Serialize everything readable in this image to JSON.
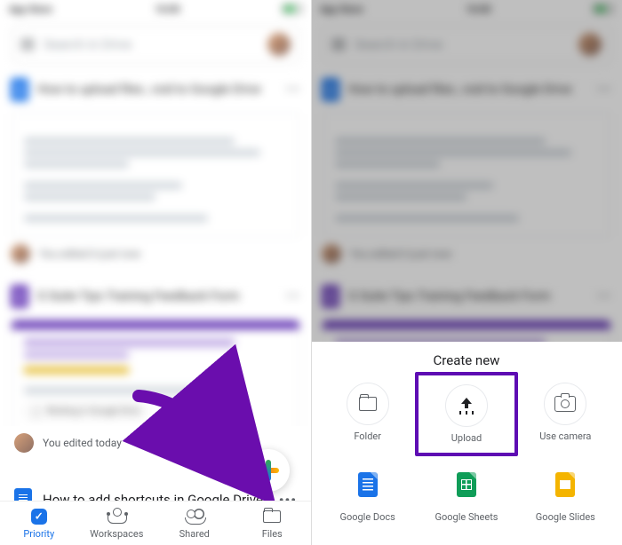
{
  "status": {
    "left": "App Store",
    "center": "16:00"
  },
  "search": {
    "placeholder": "Search in Drive"
  },
  "files": {
    "doc_upload": "How to upload files…roid to Google Drive",
    "form_title": "G Suite Tips Training Feedback Form",
    "form_sub": "Google Workspace Training Evaluation",
    "chip": "Working in Google Drive",
    "edit_justnow": "You edited it just now",
    "edit_today": "You edited today",
    "shortcut": "How to add shortcuts in Google Drive"
  },
  "nav": {
    "priority": "Priority",
    "workspaces": "Workspaces",
    "shared": "Shared",
    "files": "Files"
  },
  "sheet": {
    "title": "Create new",
    "items": [
      {
        "label": "Folder"
      },
      {
        "label": "Upload"
      },
      {
        "label": "Use camera"
      },
      {
        "label": "Google Docs"
      },
      {
        "label": "Google Sheets"
      },
      {
        "label": "Google Slides"
      }
    ]
  }
}
